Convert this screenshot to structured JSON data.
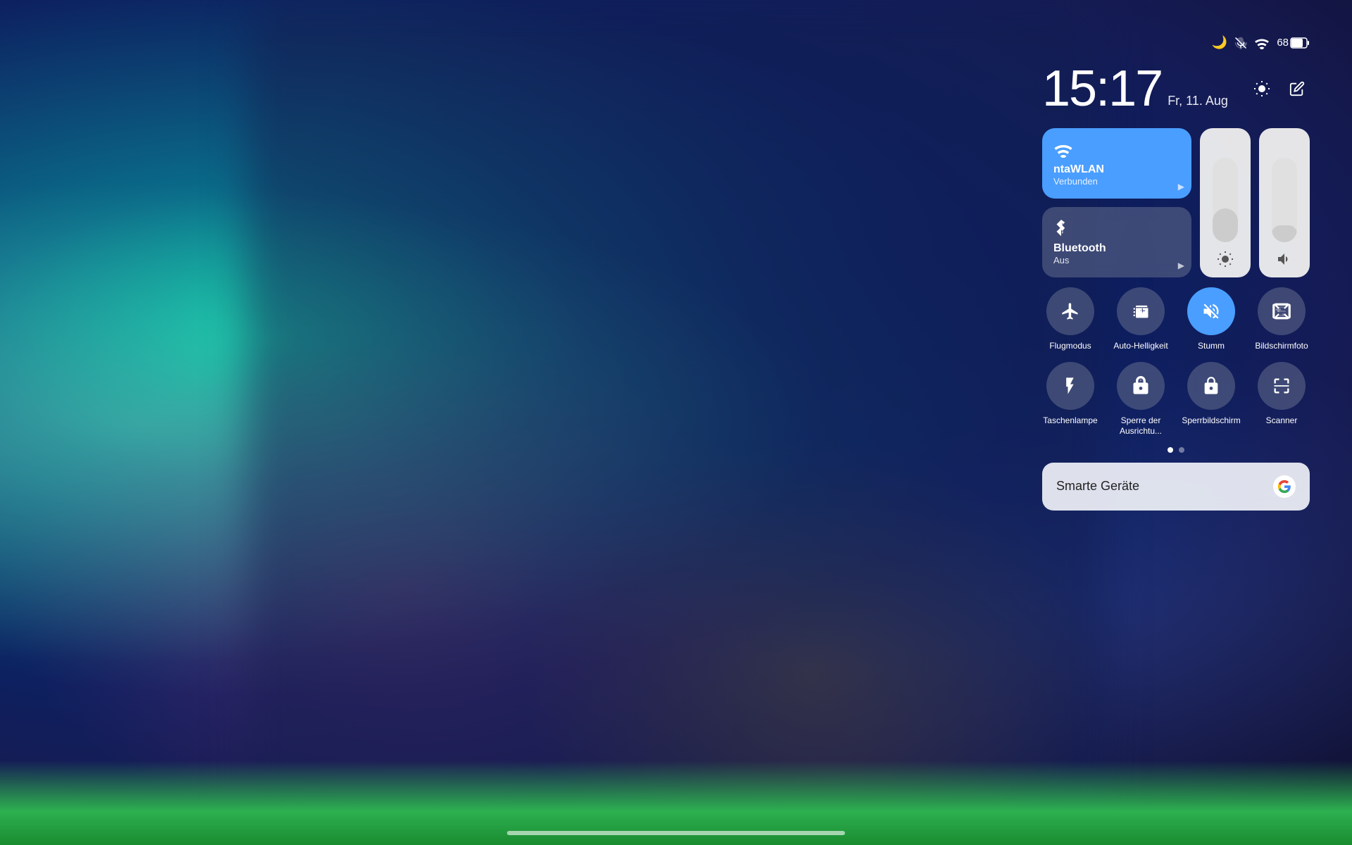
{
  "statusBar": {
    "icons": [
      "moon",
      "muted",
      "wifi",
      "battery"
    ],
    "batteryLevel": "68"
  },
  "timeHeader": {
    "time": "15:17",
    "date": "Fr, 11. Aug"
  },
  "tiles": {
    "wifi": {
      "title": "ntaWLAN",
      "subtitle": "Verbunden",
      "active": true
    },
    "bluetooth": {
      "title": "Bluetooth",
      "subtitle": "Aus",
      "active": false
    }
  },
  "quickActions": {
    "row1": [
      {
        "id": "flugmodus",
        "label": "Flugmodus",
        "active": false
      },
      {
        "id": "auto-helligkeit",
        "label": "Auto-Helligkeit",
        "active": false
      },
      {
        "id": "stumm",
        "label": "Stumm",
        "active": true
      },
      {
        "id": "bildschirmfoto",
        "label": "Bildschirmfoto",
        "active": false
      }
    ],
    "row2": [
      {
        "id": "taschenlampe",
        "label": "Taschenlampe",
        "active": false
      },
      {
        "id": "sperre-ausrichtung",
        "label": "Sperre der Ausrichtu...",
        "active": false
      },
      {
        "id": "sperrbildschirm",
        "label": "Sperrbildschirm",
        "active": false
      },
      {
        "id": "scanner",
        "label": "Scanner",
        "active": false
      }
    ]
  },
  "smartDevices": {
    "label": "Smarte Geräte"
  }
}
